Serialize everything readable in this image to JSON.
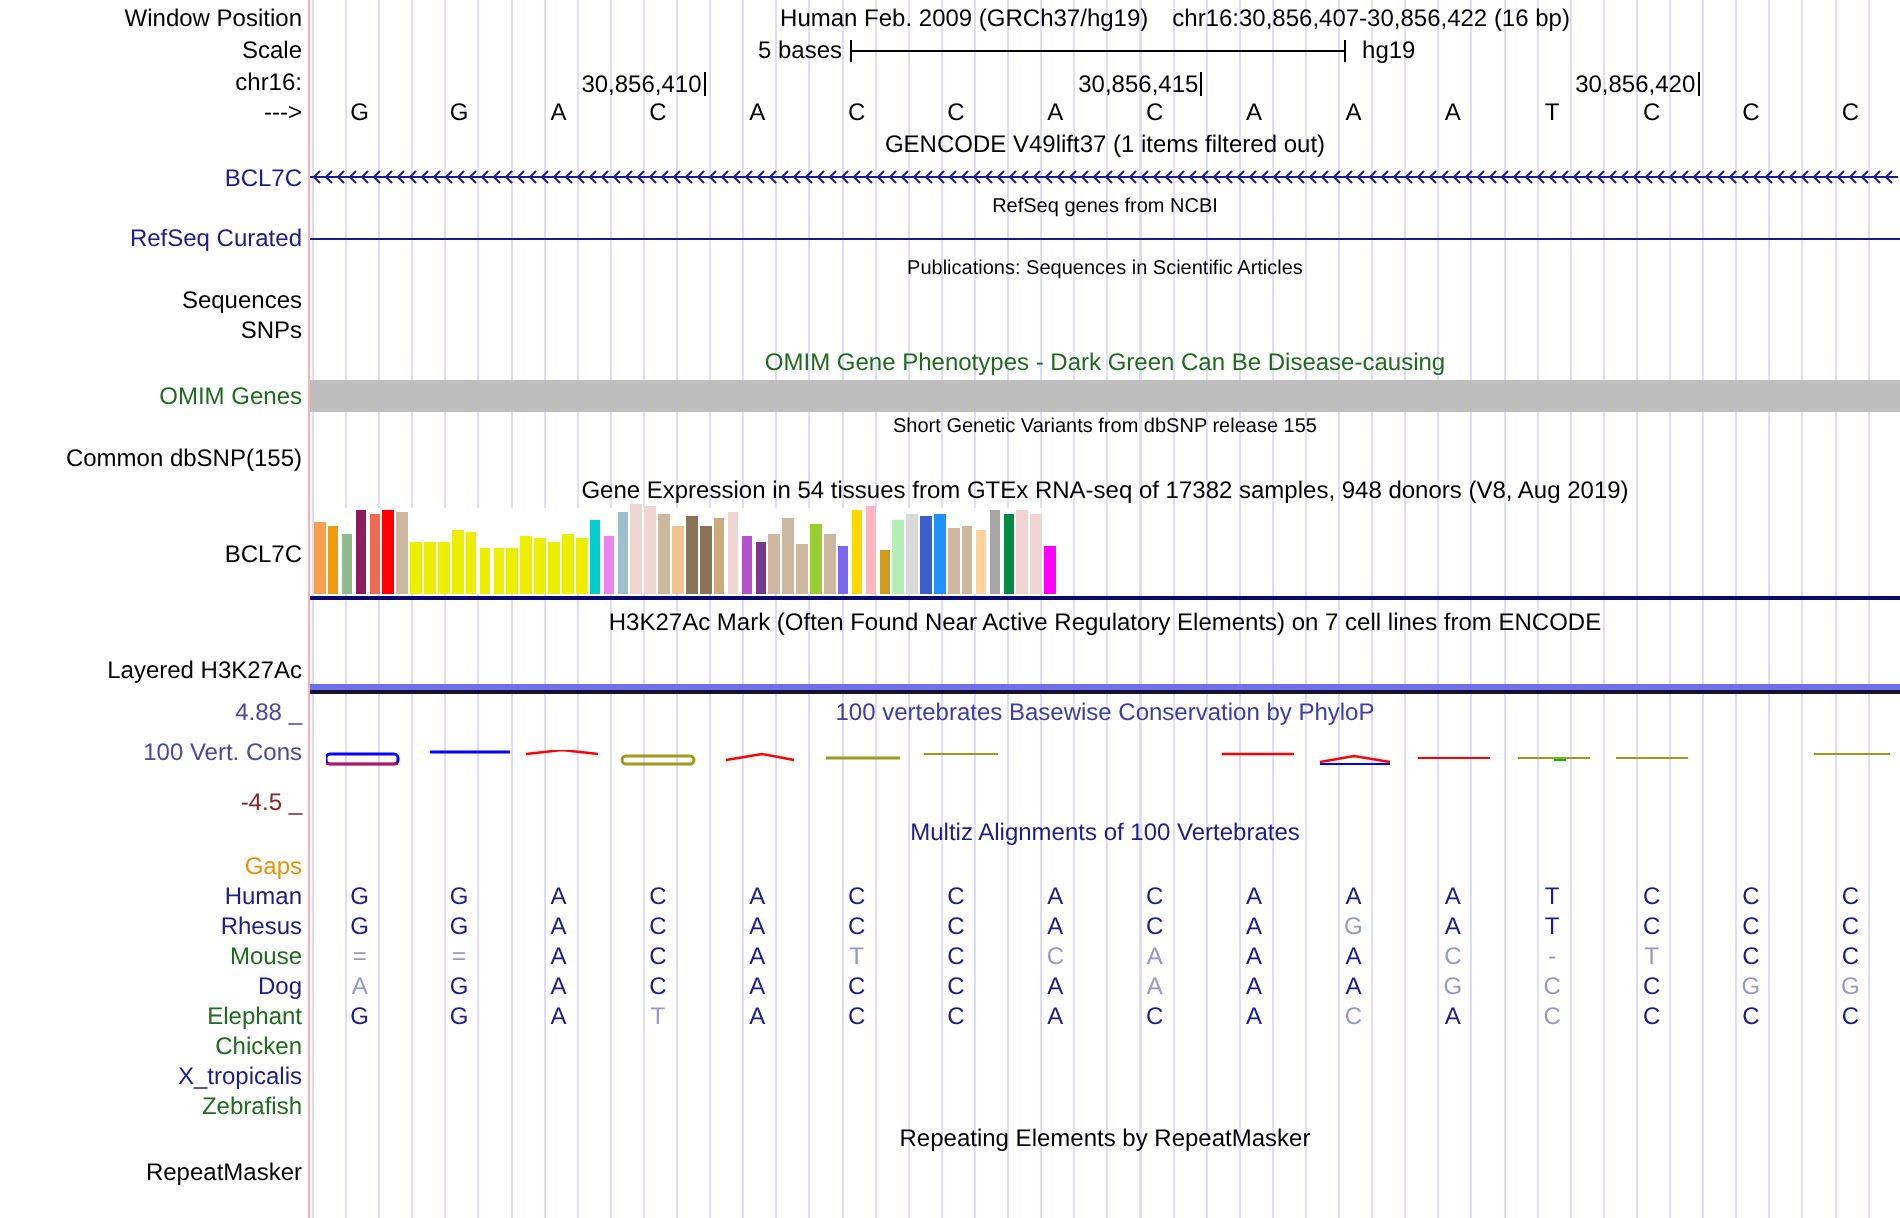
{
  "header": {
    "window_position_label": "Window Position",
    "assembly": "Human Feb. 2009 (GRCh37/hg19)",
    "position": "chr16:30,856,407-30,856,422 (16 bp)",
    "scale_label": "Scale",
    "scale_text": "5 bases",
    "scale_db": "hg19",
    "chrom_label": "chr16:",
    "ticks": [
      "30,856,410",
      "30,856,415",
      "30,856,420"
    ],
    "strand_label": "--->",
    "bases": [
      "G",
      "G",
      "A",
      "C",
      "A",
      "C",
      "C",
      "A",
      "C",
      "A",
      "A",
      "A",
      "T",
      "C",
      "C",
      "C"
    ]
  },
  "tracks": [
    {
      "kind": "gene",
      "title": "GENCODE V49lift37 (1 items filtered out)",
      "labels": [
        "BCL7C"
      ],
      "color": "#1c1c8c"
    },
    {
      "kind": "line",
      "title": "RefSeq genes from NCBI",
      "labels": [
        "RefSeq Curated"
      ],
      "color": "#1c1c8c"
    },
    {
      "kind": "empty",
      "title": "Publications: Sequences in Scientific Articles",
      "labels": [
        "Sequences",
        "SNPs"
      ],
      "color": "#000000"
    },
    {
      "kind": "bar",
      "title": "OMIM Gene Phenotypes - Dark Green Can Be Disease-causing",
      "labels": [
        "OMIM Genes"
      ],
      "color": "#1e6b1e"
    },
    {
      "kind": "empty",
      "title": "Short Genetic Variants from dbSNP release 155",
      "labels": [
        "Common dbSNP(155)"
      ],
      "color": "#000000"
    },
    {
      "kind": "expression",
      "title": "Gene Expression in 54 tissues from GTEx RNA-seq of 17382 samples, 948 donors (V8, Aug 2019)",
      "labels": [
        "BCL7C"
      ],
      "color": "#000000"
    },
    {
      "kind": "signal",
      "title": "H3K27Ac Mark (Often Found Near Active Regulatory Elements) on 7 cell lines from ENCODE",
      "labels": [
        "Layered H3K27Ac"
      ],
      "color": "#000000"
    },
    {
      "kind": "conservation",
      "title": "100 vertebrates Basewise Conservation by PhyloP",
      "labels": [
        "100 Vert. Cons"
      ],
      "color": "#4a4a9c",
      "max": "4.88 _",
      "min": "-4.5 _"
    },
    {
      "kind": "alignment",
      "title": "Multiz Alignments of 100 Vertebrates",
      "color": "#1c1c8c",
      "species": [
        {
          "name": "Gaps",
          "color": "#e8900a"
        },
        {
          "name": "Human",
          "color": "#1c1c8c",
          "bases": [
            {
              "base": "G",
              "faded": false
            },
            {
              "base": "G",
              "faded": false
            },
            {
              "base": "A",
              "faded": false
            },
            {
              "base": "C",
              "faded": false
            },
            {
              "base": "A",
              "faded": false
            },
            {
              "base": "C",
              "faded": false
            },
            {
              "base": "C",
              "faded": false
            },
            {
              "base": "A",
              "faded": false
            },
            {
              "base": "C",
              "faded": false
            },
            {
              "base": "A",
              "faded": false
            },
            {
              "base": "A",
              "faded": false
            },
            {
              "base": "A",
              "faded": false
            },
            {
              "base": "T",
              "faded": false
            },
            {
              "base": "C",
              "faded": false
            },
            {
              "base": "C",
              "faded": false
            },
            {
              "base": "C",
              "faded": false
            }
          ]
        },
        {
          "name": "Rhesus",
          "color": "#1c1c8c",
          "bases": [
            {
              "base": "G",
              "faded": false
            },
            {
              "base": "G",
              "faded": false
            },
            {
              "base": "A",
              "faded": false
            },
            {
              "base": "C",
              "faded": false
            },
            {
              "base": "A",
              "faded": false
            },
            {
              "base": "C",
              "faded": false
            },
            {
              "base": "C",
              "faded": false
            },
            {
              "base": "A",
              "faded": false
            },
            {
              "base": "C",
              "faded": false
            },
            {
              "base": "A",
              "faded": false
            },
            {
              "base": "G",
              "faded": true
            },
            {
              "base": "A",
              "faded": false
            },
            {
              "base": "T",
              "faded": false
            },
            {
              "base": "C",
              "faded": false
            },
            {
              "base": "C",
              "faded": false
            },
            {
              "base": "C",
              "faded": false
            }
          ]
        },
        {
          "name": "Mouse",
          "color": "#1e6b1e",
          "bases": [
            {
              "base": "=",
              "faded": true
            },
            {
              "base": "=",
              "faded": true
            },
            {
              "base": "A",
              "faded": false
            },
            {
              "base": "C",
              "faded": false
            },
            {
              "base": "A",
              "faded": false
            },
            {
              "base": "T",
              "faded": true
            },
            {
              "base": "C",
              "faded": false
            },
            {
              "base": "C",
              "faded": true
            },
            {
              "base": "A",
              "faded": true
            },
            {
              "base": "A",
              "faded": false
            },
            {
              "base": "A",
              "faded": false
            },
            {
              "base": "C",
              "faded": true
            },
            {
              "base": "-",
              "faded": true
            },
            {
              "base": "T",
              "faded": true
            },
            {
              "base": "C",
              "faded": false
            },
            {
              "base": "C",
              "faded": false
            }
          ]
        },
        {
          "name": "Dog",
          "color": "#1c1c8c",
          "bases": [
            {
              "base": "A",
              "faded": true
            },
            {
              "base": "G",
              "faded": false
            },
            {
              "base": "A",
              "faded": false
            },
            {
              "base": "C",
              "faded": false
            },
            {
              "base": "A",
              "faded": false
            },
            {
              "base": "C",
              "faded": false
            },
            {
              "base": "C",
              "faded": false
            },
            {
              "base": "A",
              "faded": false
            },
            {
              "base": "A",
              "faded": true
            },
            {
              "base": "A",
              "faded": false
            },
            {
              "base": "A",
              "faded": false
            },
            {
              "base": "G",
              "faded": true
            },
            {
              "base": "C",
              "faded": true
            },
            {
              "base": "C",
              "faded": false
            },
            {
              "base": "G",
              "faded": true
            },
            {
              "base": "G",
              "faded": true
            }
          ]
        },
        {
          "name": "Elephant",
          "color": "#1e6b1e",
          "bases": [
            {
              "base": "G",
              "faded": false
            },
            {
              "base": "G",
              "faded": false
            },
            {
              "base": "A",
              "faded": false
            },
            {
              "base": "T",
              "faded": true
            },
            {
              "base": "A",
              "faded": false
            },
            {
              "base": "C",
              "faded": false
            },
            {
              "base": "C",
              "faded": false
            },
            {
              "base": "A",
              "faded": false
            },
            {
              "base": "C",
              "faded": false
            },
            {
              "base": "A",
              "faded": false
            },
            {
              "base": "C",
              "faded": true
            },
            {
              "base": "A",
              "faded": false
            },
            {
              "base": "C",
              "faded": true
            },
            {
              "base": "C",
              "faded": false
            },
            {
              "base": "C",
              "faded": false
            },
            {
              "base": "C",
              "faded": false
            }
          ]
        },
        {
          "name": "Chicken",
          "color": "#1e6b1e"
        },
        {
          "name": "X_tropicalis",
          "color": "#1c1c8c"
        },
        {
          "name": "Zebrafish",
          "color": "#1e6b1e"
        }
      ]
    },
    {
      "kind": "empty",
      "title": "Repeating Elements by RepeatMasker",
      "labels": [
        "RepeatMasker"
      ],
      "color": "#000000"
    }
  ]
}
